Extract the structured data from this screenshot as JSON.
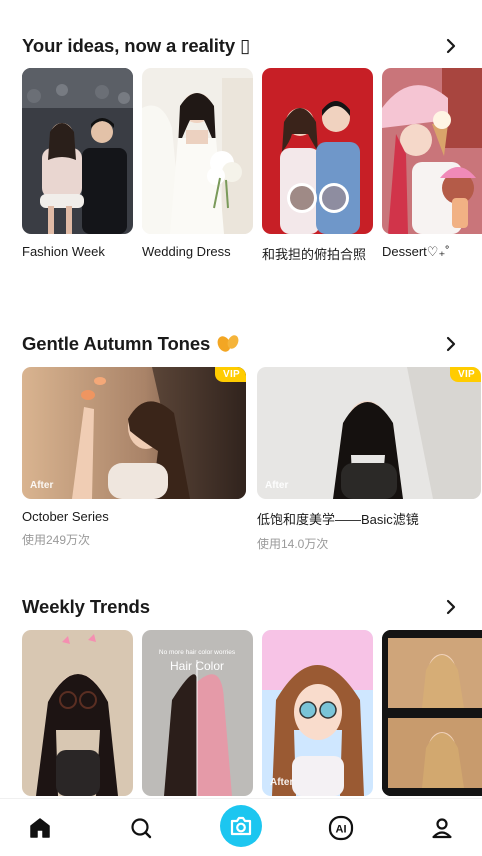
{
  "sections": [
    {
      "title": "Your ideas, now a reality ▯",
      "items": [
        {
          "label": "Fashion Week"
        },
        {
          "label": "Wedding Dress"
        },
        {
          "label": "和我担的俯拍合照"
        },
        {
          "label": "Dessert♡₊˚"
        }
      ]
    },
    {
      "title": "Gentle Autumn Tones",
      "items": [
        {
          "label": "October Series",
          "sub": "使用249万次",
          "tag": "After",
          "badge": "VIP"
        },
        {
          "label": "低饱和度美学——Basic滤镜",
          "sub": "使用14.0万次",
          "tag": "After",
          "badge": "VIP"
        }
      ]
    },
    {
      "title": "Weekly Trends",
      "items": [
        {
          "label": ""
        },
        {
          "label": "",
          "overlay_top": "No more hair color worries",
          "overlay_title": "Hair Color"
        },
        {
          "label": "",
          "tag": "After"
        },
        {
          "label": ""
        }
      ]
    }
  ],
  "nav": {
    "items": [
      "home-icon",
      "search-icon",
      "camera-icon",
      "ai-icon",
      "profile-icon"
    ],
    "active": "home-icon",
    "accent": "#1cc6f0",
    "ai_text": "AI"
  }
}
